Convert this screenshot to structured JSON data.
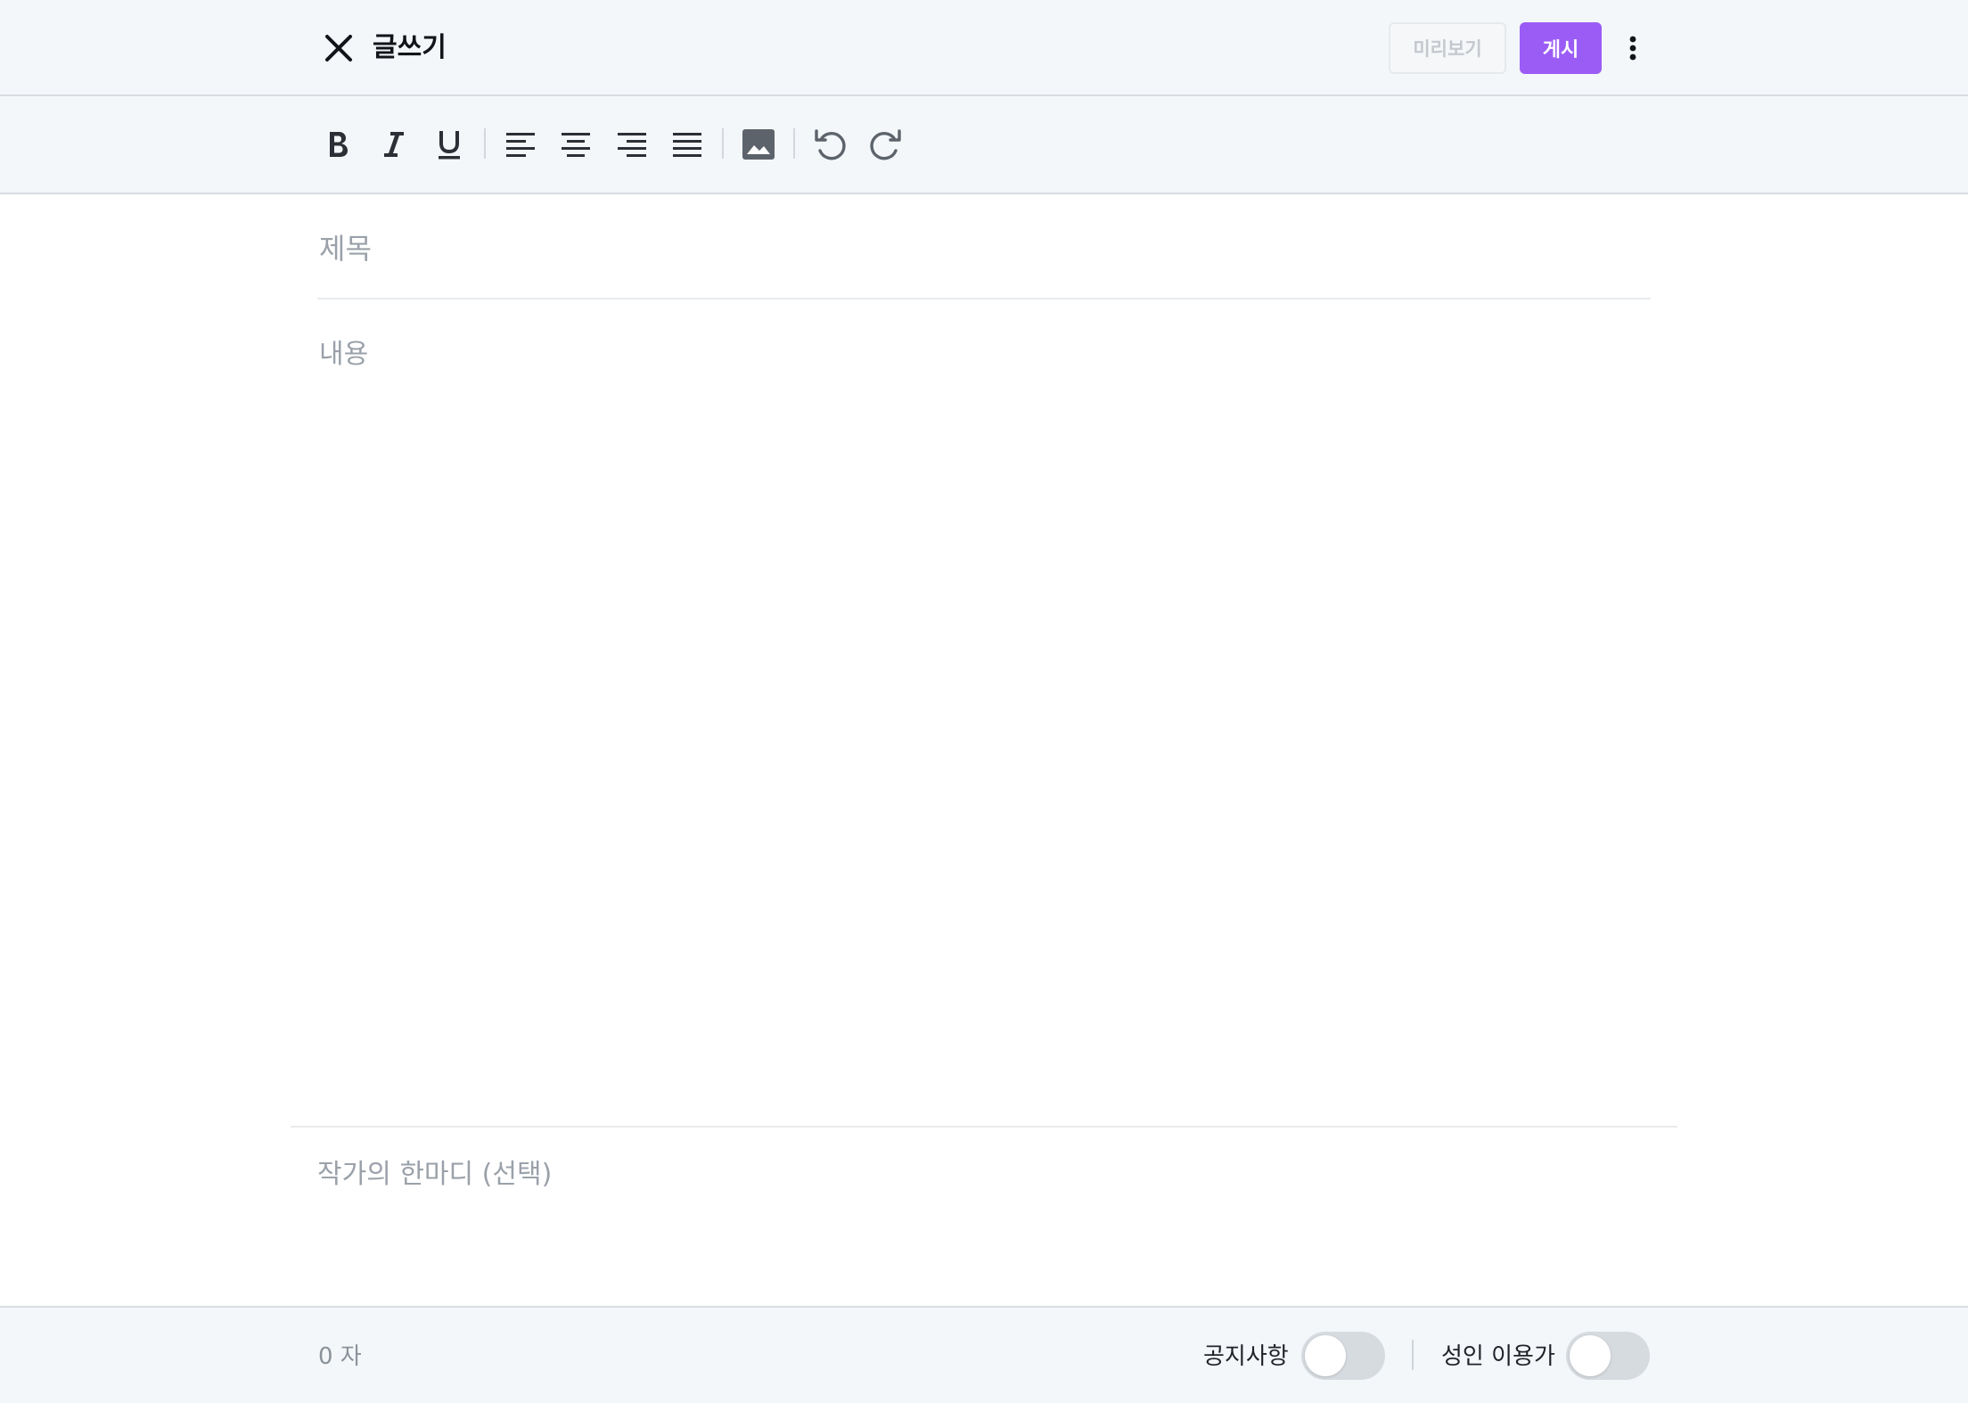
{
  "header": {
    "close_icon": "close-icon",
    "title": "글쓰기",
    "preview_label": "미리보기",
    "publish_label": "게시",
    "more_icon": "more-vertical-icon",
    "accent_color": "#9b5cf6"
  },
  "toolbar": {
    "items": [
      {
        "name": "bold",
        "icon": "bold-icon"
      },
      {
        "name": "italic",
        "icon": "italic-icon"
      },
      {
        "name": "underline",
        "icon": "underline-icon"
      },
      {
        "name": "align-left",
        "icon": "align-left-icon"
      },
      {
        "name": "align-center",
        "icon": "align-center-icon"
      },
      {
        "name": "align-right",
        "icon": "align-right-icon"
      },
      {
        "name": "align-justify",
        "icon": "align-justify-icon"
      },
      {
        "name": "insert-image",
        "icon": "image-icon"
      },
      {
        "name": "undo",
        "icon": "undo-icon"
      },
      {
        "name": "redo",
        "icon": "redo-icon"
      }
    ]
  },
  "editor": {
    "title_placeholder": "제목",
    "title_value": "",
    "body_placeholder": "내용",
    "body_value": "",
    "note_placeholder": "작가의 한마디 (선택)",
    "note_value": ""
  },
  "footer": {
    "char_count": "0 자",
    "notice_label": "공지사항",
    "notice_on": false,
    "adult_label": "성인 이용가",
    "adult_on": false
  }
}
